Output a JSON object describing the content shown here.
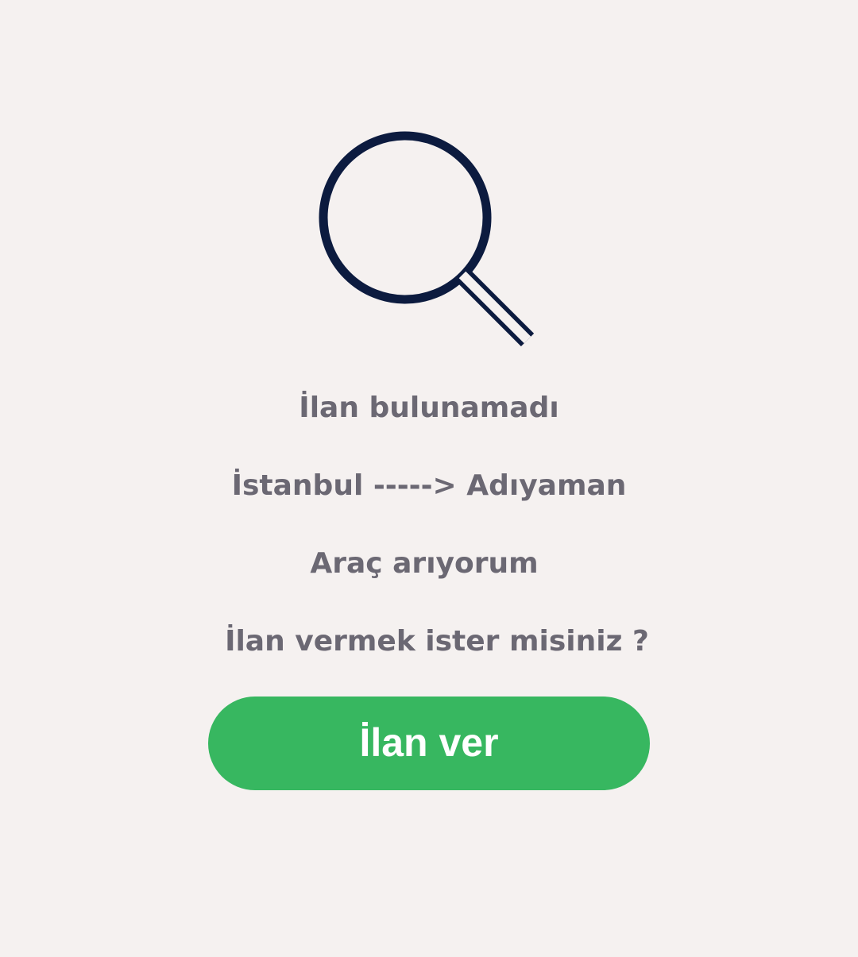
{
  "icon": {
    "name": "search-icon",
    "color": "#0c1b3f"
  },
  "colors": {
    "background": "#f5f1f0",
    "text": "#6b6873",
    "button": "#37b760",
    "button_text": "#ffffff"
  },
  "empty_state": {
    "title": "İlan bulunamadı",
    "route": "İstanbul -----> Adıyaman",
    "type": "Araç arıyorum",
    "question": "İlan vermek ister misiniz ?",
    "button_label": "İlan ver"
  }
}
